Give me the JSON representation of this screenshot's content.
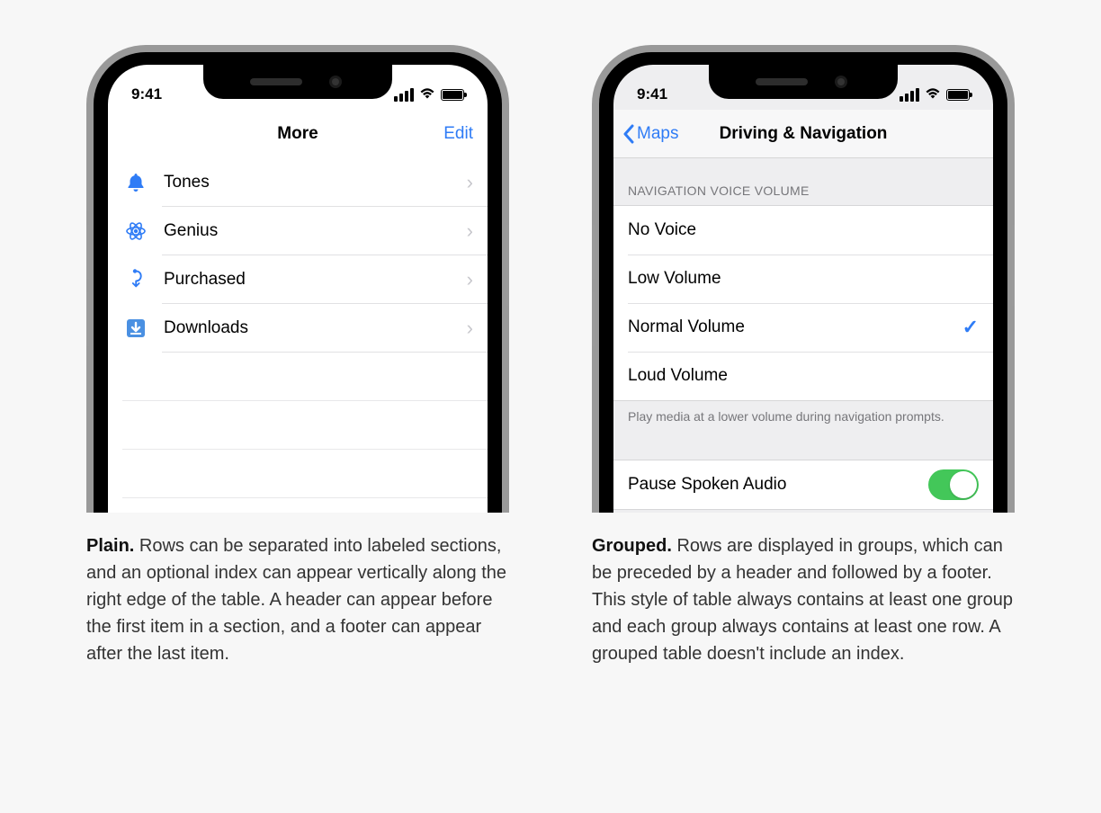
{
  "status": {
    "time": "9:41"
  },
  "left": {
    "nav_title": "More",
    "nav_right": "Edit",
    "rows": [
      {
        "label": "Tones"
      },
      {
        "label": "Genius"
      },
      {
        "label": "Purchased"
      },
      {
        "label": "Downloads"
      }
    ],
    "caption_bold": "Plain.",
    "caption_text": " Rows can be separated into labeled sections, and an optional index can appear vertically along the right edge of the table. A header can appear before the first item in a section, and a footer can appear after the last item."
  },
  "right": {
    "nav_back": "Maps",
    "nav_title": "Driving & Navigation",
    "section1_header": "NAVIGATION VOICE VOLUME",
    "options": [
      {
        "label": "No Voice",
        "selected": false
      },
      {
        "label": "Low Volume",
        "selected": false
      },
      {
        "label": "Normal Volume",
        "selected": true
      },
      {
        "label": "Loud Volume",
        "selected": false
      }
    ],
    "section1_footer": "Play media at a lower volume during navigation prompts.",
    "toggle_label": "Pause Spoken Audio",
    "caption_bold": "Grouped.",
    "caption_text": " Rows are displayed in groups, which can be preceded by a header and followed by a footer. This style of table always contains at least one group and each group always contains at least one row. A grouped table doesn't include an index."
  }
}
